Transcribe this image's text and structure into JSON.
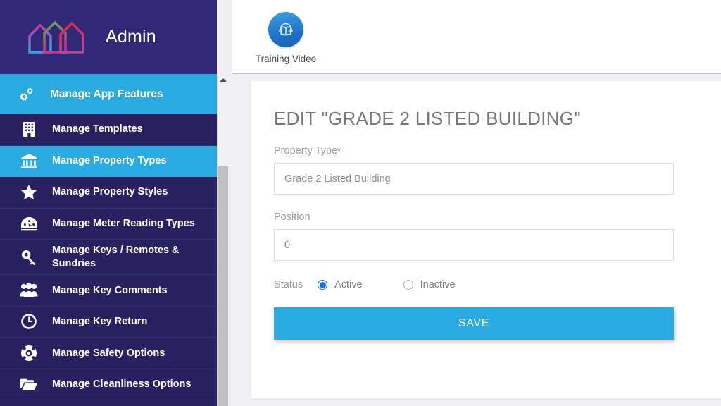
{
  "brand": {
    "title": "Admin",
    "logo_icon": "three-houses-logo-icon"
  },
  "sidebar": {
    "items": [
      {
        "label": "Manage App Features",
        "icon": "cogs-icon",
        "active": true,
        "header": true
      },
      {
        "label": "Manage Templates",
        "icon": "building-icon",
        "active": false,
        "header": false
      },
      {
        "label": "Manage Property Types",
        "icon": "bank-icon",
        "active": true,
        "header": false
      },
      {
        "label": "Manage Property Styles",
        "icon": "star-icon",
        "active": false,
        "header": false
      },
      {
        "label": "Manage Meter Reading Types",
        "icon": "gauge-icon",
        "active": false,
        "header": false
      },
      {
        "label": "Manage Keys / Remotes & Sundries",
        "icon": "key-icon",
        "active": false,
        "header": false
      },
      {
        "label": "Manage Key Comments",
        "icon": "users-icon",
        "active": false,
        "header": false
      },
      {
        "label": "Manage Key Return",
        "icon": "clock-icon",
        "active": false,
        "header": false
      },
      {
        "label": "Manage Safety Options",
        "icon": "life-ring-icon",
        "active": false,
        "header": false
      },
      {
        "label": "Manage Cleanliness Options",
        "icon": "folder-open-icon",
        "active": false,
        "header": false
      }
    ],
    "scrollbar": {
      "up_arrow_icon": "triangle-up-icon"
    }
  },
  "topbar": {
    "training_video": {
      "label": "Training Video",
      "icon": "training-video-icon"
    }
  },
  "form": {
    "title": "EDIT \"GRADE 2 LISTED BUILDING\"",
    "property_type": {
      "label": "Property Type",
      "required_mark": "*",
      "value": "Grade 2 Listed Building",
      "placeholder": "Property Type"
    },
    "position": {
      "label": "Position",
      "value": "0",
      "placeholder": "Position"
    },
    "status": {
      "label": "Status",
      "options": [
        {
          "label": "Active",
          "selected": true
        },
        {
          "label": "Inactive",
          "selected": false
        }
      ]
    },
    "save_label": "SAVE"
  },
  "colors": {
    "sidebar_bg": "#2a2160",
    "brand_bg": "#322878",
    "accent_blue": "#29abe2",
    "page_bg": "#f0f0f4",
    "required_red": "#e8545c",
    "radio_blue": "#1a73e8"
  }
}
